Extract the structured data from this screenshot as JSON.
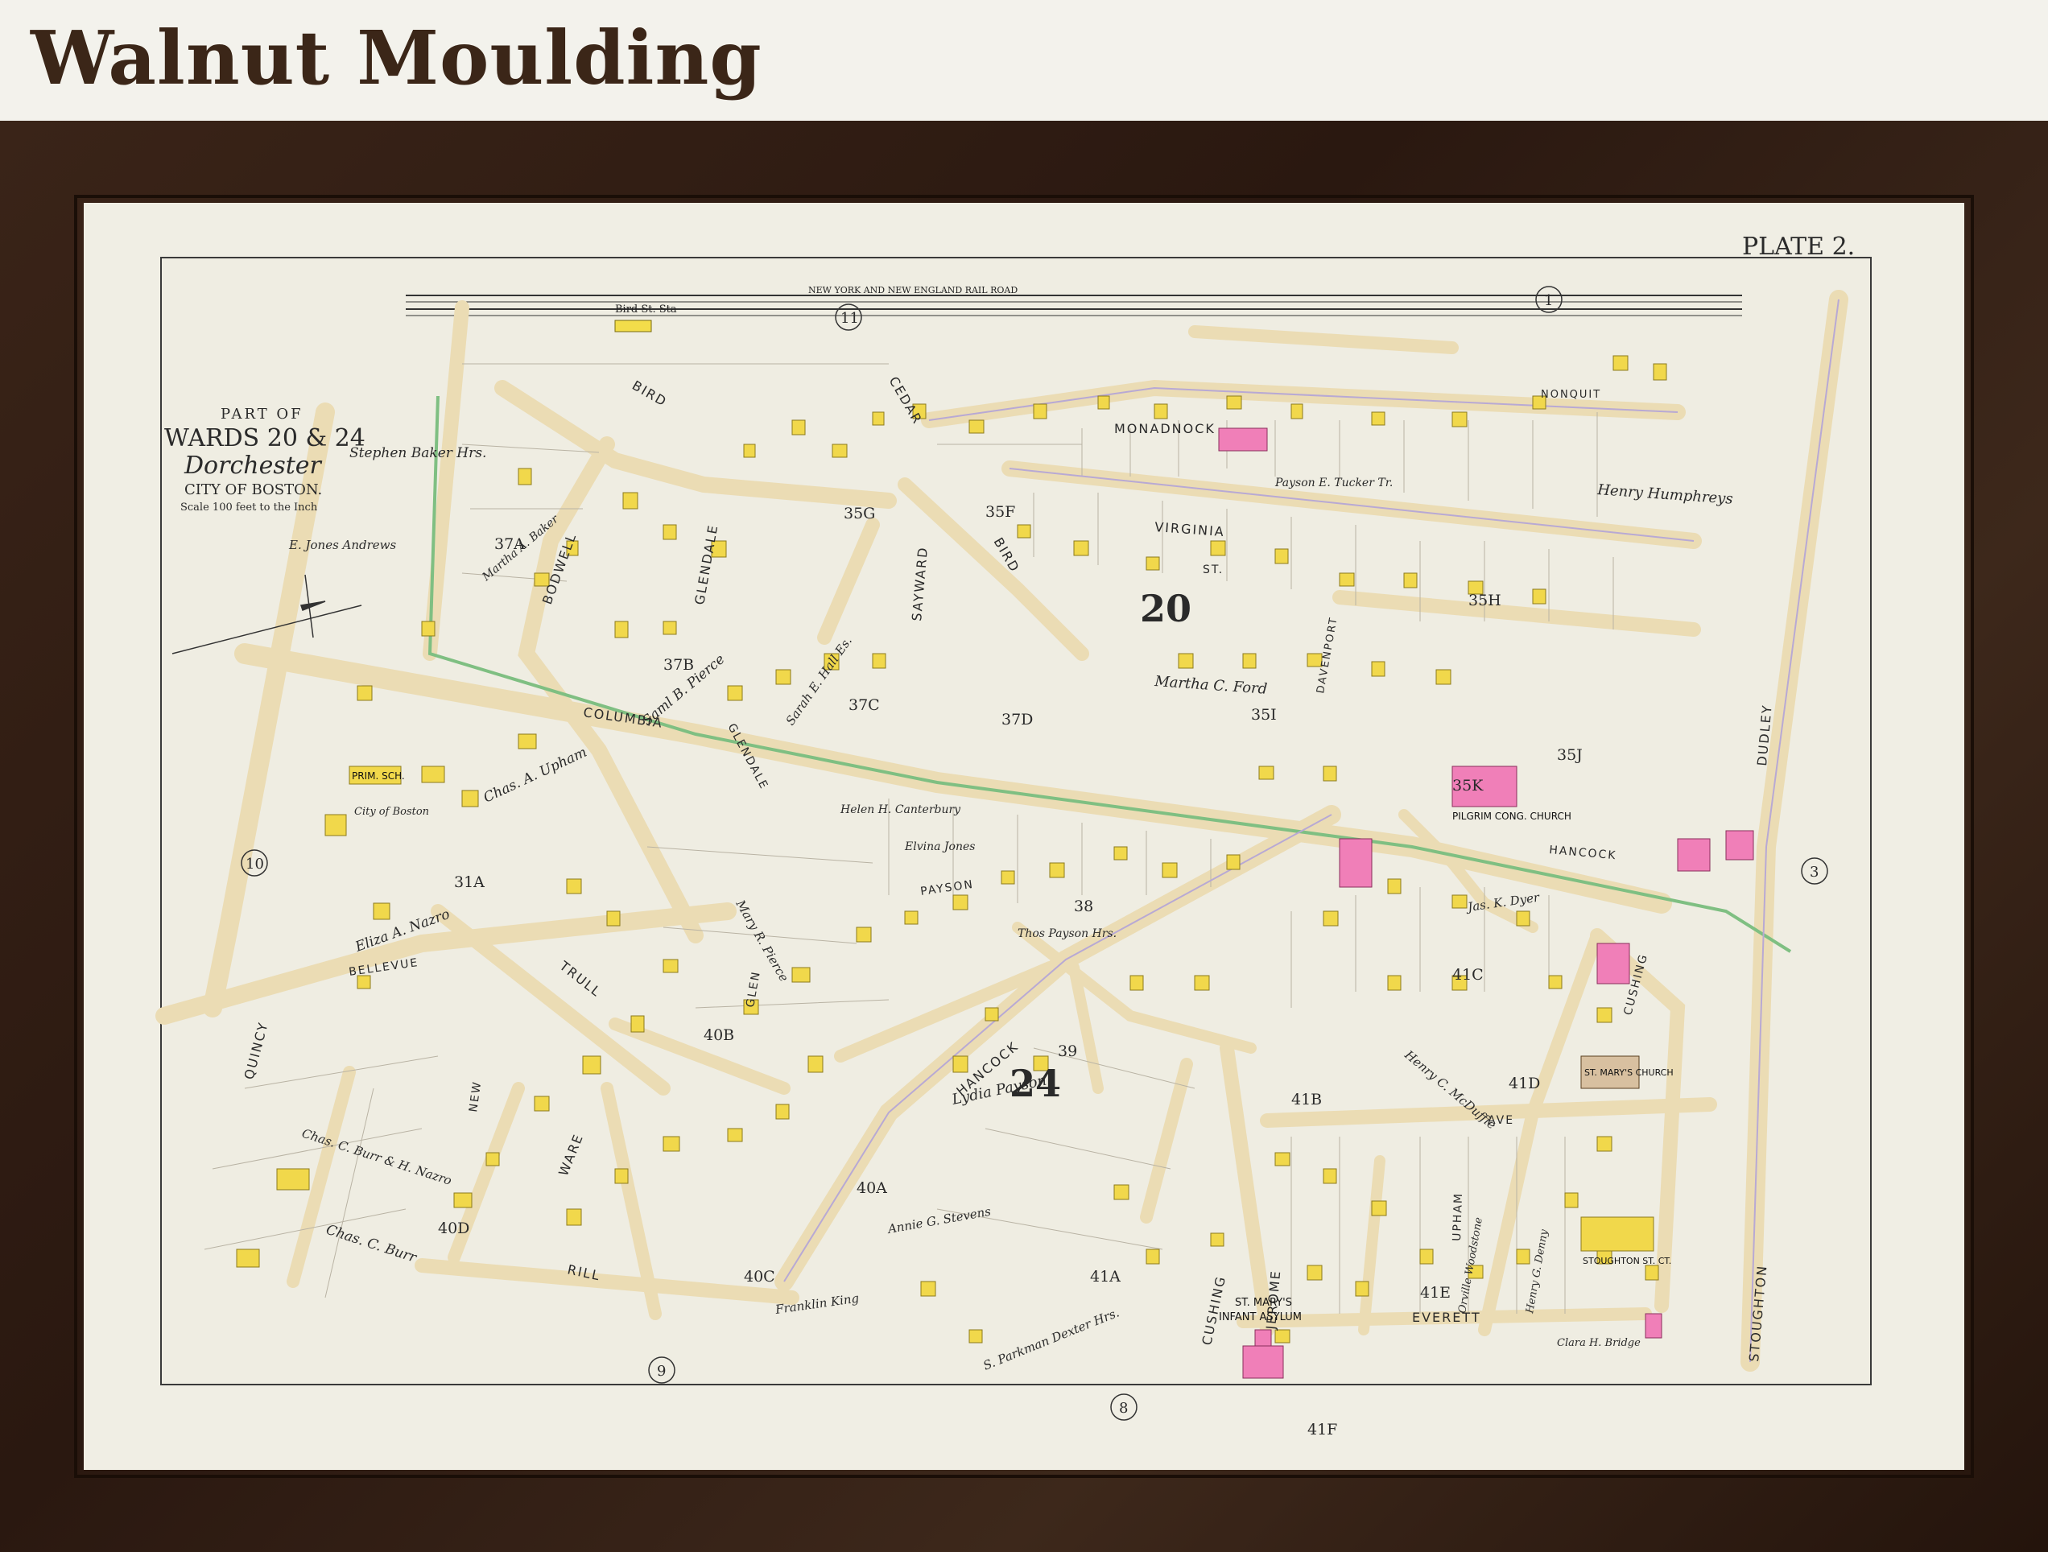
{
  "header": {
    "title": "Walnut Moulding"
  },
  "map": {
    "plate": "PLATE 2.",
    "title_line1": "PART OF",
    "title_line2": "WARDS 20 & 24",
    "title_line3": "Dorchester",
    "title_line4": "CITY OF BOSTON.",
    "scale": "Scale 100 feet to the Inch",
    "railroad": "NEW   YORK   AND   NEW   ENGLAND   RAIL   ROAD",
    "station": "Bird St. Sta",
    "plate_refs": [
      "11",
      "1",
      "10",
      "3",
      "9",
      "8"
    ],
    "ward_numbers": [
      "20",
      "24"
    ],
    "streets": {
      "monadnock": "MONADNOCK",
      "nonquit": "NONQUIT",
      "virginia": "VIRGINIA",
      "columbia": "COLUMBIA",
      "hancock": "HANCOCK",
      "bellevue": "BELLEVUE",
      "quincy": "QUINCY",
      "trull": "TRULL",
      "ware": "WARE",
      "rill": "RILL",
      "glendale": "GLENDALE",
      "sayward": "SAYWARD",
      "bird": "BIRD",
      "cedar": "CEDAR",
      "bowdoin": "BODWELL",
      "dudley": "DUDLEY",
      "stoughton": "STOUGHTON",
      "cushing": "CUSHING",
      "jerome": "JEROME",
      "everett": "EVERETT",
      "upham": "UPHAM",
      "davenport": "DAVENPORT",
      "payson": "PAYSON",
      "glen": "GLEN",
      "new": "NEW",
      "st": "ST.",
      "ave": "AVE"
    },
    "blocks": [
      "37A",
      "37B",
      "37C",
      "37D",
      "35G",
      "35F",
      "35H",
      "35I",
      "35J",
      "35K",
      "31A",
      "38",
      "39",
      "40A",
      "40B",
      "40C",
      "40D",
      "41A",
      "41B",
      "41C",
      "41D",
      "41E",
      "41F"
    ],
    "owners": [
      "Stephen Baker Hrs.",
      "E. Jones Andrews",
      "Martha A. Baker",
      "Saml B. Pierce",
      "Sarah E. Hall Es.",
      "Martha C. Ford",
      "Henry Humphreys",
      "Payson E. Tucker Tr.",
      "Chas. A. Upham",
      "City of Boston",
      "Eliza A. Nazro",
      "Chas. C. Burr & H. Nazro",
      "Chas. C. Burr",
      "Mary R. Pierce",
      "Helen H. Canterbury",
      "Elvina Jones",
      "Thos Payson Hrs.",
      "Lydia Payson",
      "Annie G. Stevens",
      "Franklin King",
      "S. Parkman Dexter Hrs.",
      "Henry C. McDuffie",
      "Jas. K. Dyer",
      "Orville Woodstone",
      "Henry G. Denny",
      "Clara H. Bridge"
    ],
    "landmarks": {
      "prim_sch": "PRIM. SCH.",
      "pilgrim": "PILGRIM CONG. CHURCH",
      "st_marys_church": "ST. MARY'S CHURCH",
      "asylum_line1": "ST. MARY'S",
      "asylum_line2": "INFANT ASYLUM",
      "stoughton_st_ct": "STOUGHTON ST. CT."
    }
  }
}
